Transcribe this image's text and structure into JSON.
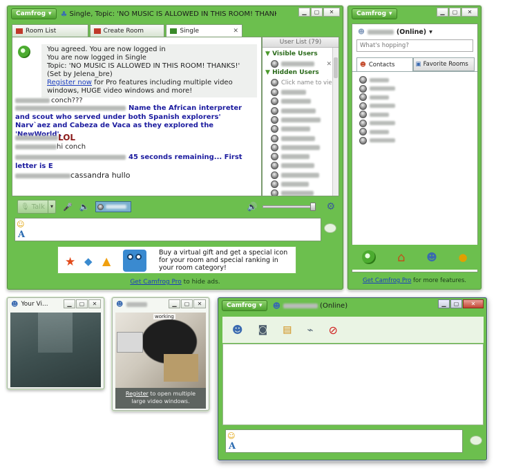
{
  "main": {
    "camfrog_label": "Camfrog",
    "title": "Single, Topic: 'NO MUSIC IS ALLOWED IN THIS ROOM! THANKS!' (Set by Jelena_...",
    "tabs": [
      {
        "label": "Room List"
      },
      {
        "label": "Create Room"
      },
      {
        "label": "Single"
      }
    ],
    "system_msg": {
      "line1": "You agreed. You are now logged in",
      "line2": "You are now logged in Single",
      "line3": "Topic: 'NO MUSIC IS ALLOWED IN THIS ROOM! THANKS!' (Set by Jelena_bre)",
      "register_link": "Register now",
      "register_rest": " for Pro features including multiple video windows, HUGE video windows and more!"
    },
    "chat": [
      {
        "text": "conch???"
      },
      {
        "text": "Name the African interpreter and scout who served under both Spanish explorers' Narv`aez and Cabeza de Vaca as they explored the 'NewWorld'."
      },
      {
        "text": "LOL"
      },
      {
        "text": "hi conch"
      },
      {
        "text": "45 seconds remaining... First letter is E"
      },
      {
        "text": "cassandra hullo"
      }
    ],
    "user_list_header": "User List (79)",
    "visible_users": "Visible Users",
    "hidden_users": "Hidden Users",
    "click_to_view": "Click name to view",
    "talk_label": "Talk",
    "promo_text": "Buy a virtual gift and get a special icon for your room and special ranking in your room category!",
    "footer_link": "Get Camfrog Pro",
    "footer_rest": " to hide ads."
  },
  "contacts_win": {
    "camfrog_label": "Camfrog",
    "status": "(Online)",
    "hopping_placeholder": "What's hopping?",
    "tabs": [
      {
        "label": "Contacts"
      },
      {
        "label": "Favorite Rooms"
      }
    ],
    "footer_link": "Get Camfrog Pro",
    "footer_rest": " for more features."
  },
  "video_own": {
    "title": "Your Vi..."
  },
  "video_user": {
    "overlay": "working",
    "register_link": "Register",
    "register_rest": " to open multiple large video windows."
  },
  "pm_win": {
    "camfrog_label": "Camfrog",
    "status": "(Online)"
  },
  "colors": {
    "accent": "#6cbf4e",
    "chat_blue": "#1a1a9e",
    "lol_red": "#8b1a1a",
    "link": "#1a3dbf"
  }
}
